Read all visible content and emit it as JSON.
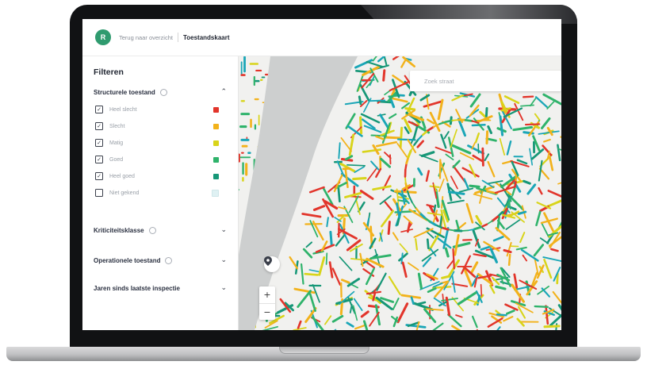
{
  "header": {
    "logo_text": "R",
    "back_label": "Terug naar overzicht",
    "page_title": "Toestandskaart"
  },
  "sidebar": {
    "title": "Filteren",
    "sections": [
      {
        "label": "Structurele toestand",
        "expanded": true,
        "items": [
          {
            "label": "Heel slecht",
            "checked": true,
            "color": "#e2352b"
          },
          {
            "label": "Slecht",
            "checked": true,
            "color": "#f2b21b"
          },
          {
            "label": "Matig",
            "checked": true,
            "color": "#d8d41a"
          },
          {
            "label": "Goed",
            "checked": true,
            "color": "#2fb36b"
          },
          {
            "label": "Heel goed",
            "checked": true,
            "color": "#169777"
          },
          {
            "label": "Niet gekend",
            "checked": false,
            "color": "#dff1f3"
          }
        ]
      },
      {
        "label": "Kriticiteitsklasse",
        "expanded": false
      },
      {
        "label": "Operationele toestand",
        "expanded": false
      },
      {
        "label": "Jaren sinds laatste inspectie",
        "expanded": false
      }
    ]
  },
  "map": {
    "search_placeholder": "Zoek straat",
    "zoom_in_label": "+",
    "zoom_out_label": "−",
    "river_color": "#cdcfcf",
    "background_color": "#f1f1ef",
    "pipe_colors": [
      "#e2352b",
      "#f2b21b",
      "#d8d41a",
      "#2fb36b",
      "#169777",
      "#1aa6b7"
    ]
  },
  "icons": {
    "chevron_up": "⌃",
    "chevron_down": "⌄",
    "checkbox_checked": "✓",
    "locate": "location-icon"
  }
}
